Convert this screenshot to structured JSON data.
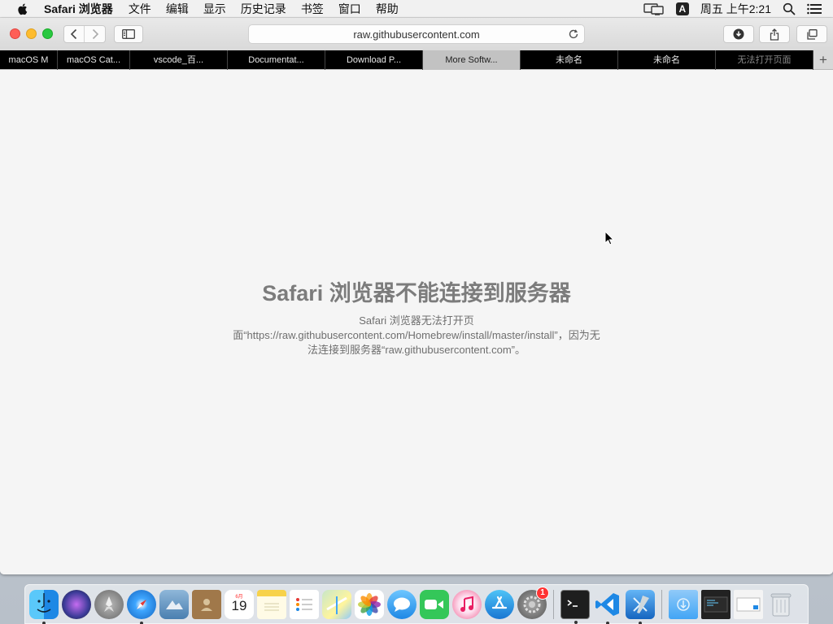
{
  "menubar": {
    "app_name": "Safari 浏览器",
    "items": [
      "文件",
      "编辑",
      "显示",
      "历史记录",
      "书签",
      "窗口",
      "帮助"
    ],
    "input_source": "A",
    "clock": "周五 上午2:21"
  },
  "toolbar": {
    "url": "raw.githubusercontent.com"
  },
  "tabs": [
    {
      "label": "macOS M"
    },
    {
      "label": "macOS Cat..."
    },
    {
      "label": "vscode_百..."
    },
    {
      "label": "Documentat..."
    },
    {
      "label": "Download P..."
    },
    {
      "label": "More Softw..."
    },
    {
      "label": "未命名"
    },
    {
      "label": "未命名"
    },
    {
      "label": "无法打开页面"
    }
  ],
  "new_tab_label": "+",
  "page": {
    "title": "Safari 浏览器不能连接到服务器",
    "message": "Safari 浏览器无法打开页面“https://raw.githubusercontent.com/Homebrew/install/master/install”，因为无法连接到服务器“raw.githubusercontent.com”。"
  },
  "dock": {
    "calendar_month": "6月",
    "calendar_day": "19",
    "system_prefs_badge": "1",
    "icons": [
      "finder-icon",
      "siri-icon",
      "launchpad-icon",
      "safari-icon",
      "mail-icon",
      "contacts-icon",
      "calendar-icon",
      "notes-icon",
      "reminders-icon",
      "maps-icon",
      "photos-icon",
      "messages-icon",
      "facetime-icon",
      "itunes-icon",
      "app-store-icon",
      "system-preferences-icon",
      "terminal-icon",
      "vscode-icon",
      "xcode-icon",
      "downloads-folder-icon",
      "screenshot-stack-icon",
      "preview-stack-icon",
      "trash-icon"
    ]
  },
  "colors": {
    "error_title": "#7c7c7c",
    "error_text": "#6f6f6f",
    "active_tab": "#c2c2c2",
    "tab_strip": "#000000"
  }
}
